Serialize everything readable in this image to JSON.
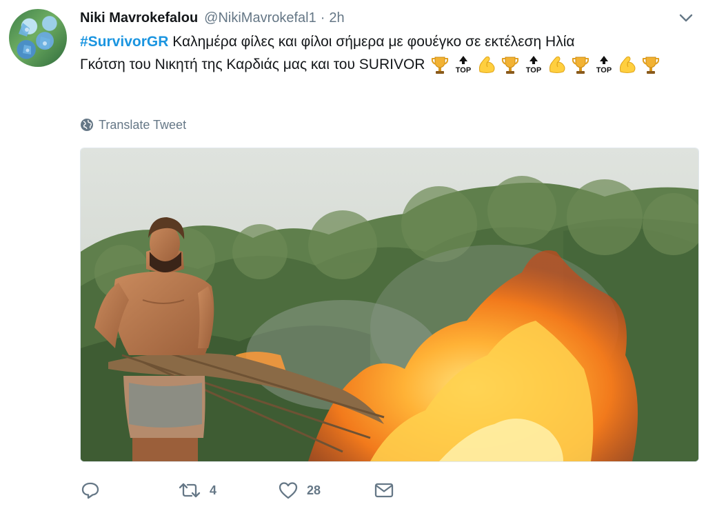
{
  "tweet": {
    "display_name": "Niki Mavrokefalou",
    "handle": "@NikiMavrokefal1",
    "separator": "·",
    "time": "2h",
    "hashtag": "#SurvivorGR",
    "text_line1": " Καλημέρα φίλες και φίλοι σήμερα με φουέγκο σε εκτέλεση Ηλία",
    "text_line2": "Γκότση του Νικητή της Καρδιάς μας και του SURIVOR",
    "emoji_sequence": [
      "trophy-icon",
      "top-arrow-icon",
      "flexed-biceps-icon",
      "trophy-icon",
      "top-arrow-icon",
      "flexed-biceps-icon",
      "trophy-icon",
      "top-arrow-icon",
      "flexed-biceps-icon",
      "trophy-icon"
    ],
    "top_label": "TOP",
    "translate_label": "Translate Tweet"
  },
  "actions": {
    "retweet_count": "4",
    "like_count": "28"
  },
  "colors": {
    "link": "#1b95e0",
    "secondary_text": "#657786",
    "primary_text": "#14171a"
  }
}
